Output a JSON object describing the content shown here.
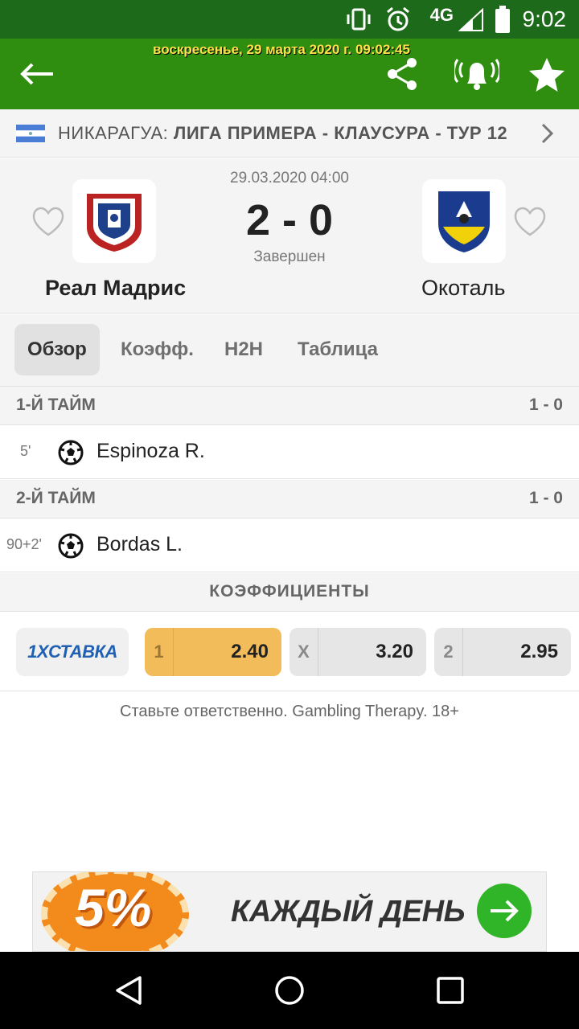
{
  "status_bar": {
    "network": "4G",
    "time": "9:02"
  },
  "header": {
    "datetime": "воскресенье, 29 марта 2020 г. 09:02:45"
  },
  "breadcrumb": {
    "country": "НИКАРАГУА:",
    "league": "ЛИГА ПРИМЕРА - КЛАУСУРА - ТУР 12"
  },
  "match": {
    "date": "29.03.2020 04:00",
    "score": "2 - 0",
    "status": "Завершен",
    "home_team": "Реал Мадрис",
    "away_team": "Окоталь"
  },
  "tabs": [
    {
      "label": "Обзор",
      "active": true
    },
    {
      "label": "Коэфф.",
      "active": false
    },
    {
      "label": "H2H",
      "active": false
    },
    {
      "label": "Таблица",
      "active": false
    }
  ],
  "periods": [
    {
      "title": "1-Й ТАЙМ",
      "score": "1 - 0",
      "events": [
        {
          "minute": "5'",
          "player": "Espinoza R."
        }
      ]
    },
    {
      "title": "2-Й ТАЙМ",
      "score": "1 - 0",
      "events": [
        {
          "minute": "90+2'",
          "player": "Bordas L."
        }
      ]
    }
  ],
  "odds": {
    "title": "КОЭФФИЦИЕНТЫ",
    "bookmaker": "1XСТАВКА",
    "items": [
      {
        "label": "1",
        "value": "2.40"
      },
      {
        "label": "X",
        "value": "3.20"
      },
      {
        "label": "2",
        "value": "2.95"
      }
    ]
  },
  "disclaimer": "Ставьте ответственно. Gambling Therapy. 18+",
  "banner": {
    "percent": "5%",
    "text": "КАЖДЫЙ ДЕНЬ"
  },
  "colors": {
    "appbar": "#2f8e0f",
    "status_bar": "#1d6a1a",
    "highlight_odd": "#f3bc5a",
    "banner_go": "#31b528"
  },
  "icons": [
    "back-arrow-icon",
    "share-icon",
    "bell-icon",
    "star-icon",
    "chevron-right-icon",
    "heart-icon",
    "football-icon",
    "nav-back-icon",
    "nav-home-icon",
    "nav-recents-icon"
  ]
}
